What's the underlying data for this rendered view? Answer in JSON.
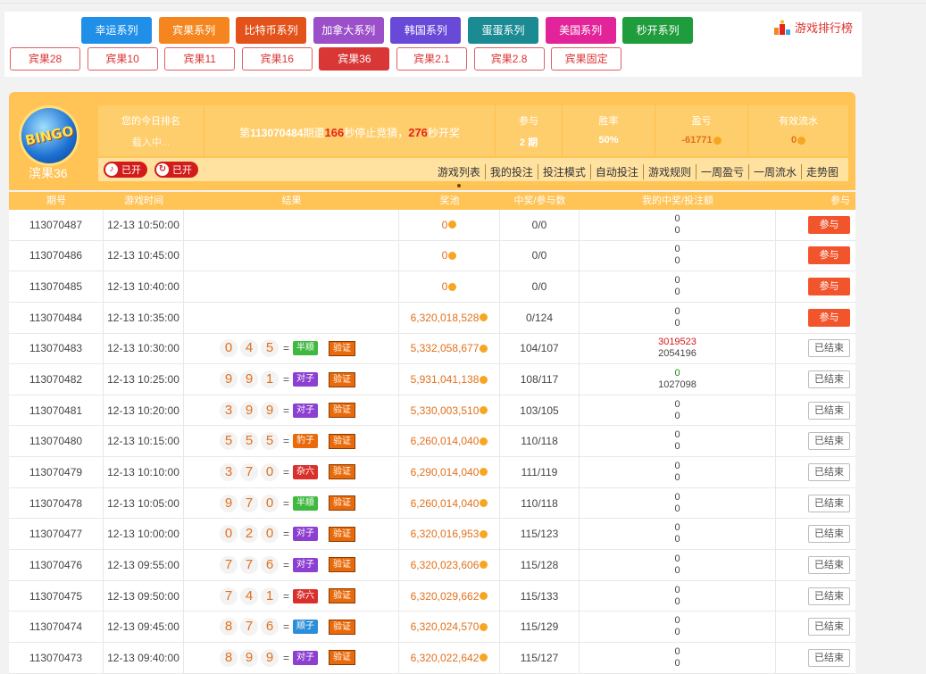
{
  "colors": {
    "accent": "#ffc356",
    "join": "#f2542c",
    "series": [
      "#1f8fe8",
      "#f5861f",
      "#e4521b",
      "#9b4fc9",
      "#6849d8",
      "#1a8a93",
      "#e2239a",
      "#1f9c3c"
    ]
  },
  "series": [
    "幸运系列",
    "宾果系列",
    "比特币系列",
    "加拿大系列",
    "韩国系列",
    "蛋蛋系列",
    "美国系列",
    "秒开系列"
  ],
  "rank_link": "游戏排行榜",
  "games": [
    "宾果28",
    "宾果10",
    "宾果11",
    "宾果16",
    "宾果36",
    "宾果2.1",
    "宾果2.8",
    "宾果固定"
  ],
  "header": {
    "game_name": "滨果36",
    "rank_label": "您的今日排名",
    "rank_value": "载入中...",
    "period_prefix": "第",
    "period_no": "113070484",
    "period_mid": "期還",
    "stop_secs": "166",
    "stop_text": "秒停止竞猜，",
    "open_secs": "276",
    "open_text": "秒开奖",
    "join_label": "参与",
    "join_value": "2 期",
    "winrate_label": "胜率",
    "winrate_value": "50%",
    "profit_label": "盈亏",
    "profit_value": "-61771",
    "flow_label": "有效流水",
    "flow_value": "0",
    "toggle1": "已开",
    "toggle2": "已开",
    "tabs": [
      "游戏列表",
      "我的投注",
      "投注模式",
      "自动投注",
      "游戏规则",
      "一周盈亏",
      "一周流水",
      "走势图"
    ]
  },
  "table": {
    "headers": [
      "期号",
      "游戏时间",
      "结果",
      "奖池",
      "中奖/参与数",
      "我的中奖/投注额",
      "参与"
    ],
    "join_btn": "参与",
    "done_btn": "已结束",
    "verify_btn": "验证",
    "rows": [
      {
        "issue": "113070487",
        "time": "12-13 10:50:00",
        "digits": [],
        "tag": "",
        "tag_color": "",
        "pool": "0",
        "wins": "0/0",
        "win": "0",
        "bet": "0",
        "status": "join"
      },
      {
        "issue": "113070486",
        "time": "12-13 10:45:00",
        "digits": [],
        "tag": "",
        "tag_color": "",
        "pool": "0",
        "wins": "0/0",
        "win": "0",
        "bet": "0",
        "status": "join"
      },
      {
        "issue": "113070485",
        "time": "12-13 10:40:00",
        "digits": [],
        "tag": "",
        "tag_color": "",
        "pool": "0",
        "wins": "0/0",
        "win": "0",
        "bet": "0",
        "status": "join"
      },
      {
        "issue": "113070484",
        "time": "12-13 10:35:00",
        "digits": [],
        "tag": "",
        "tag_color": "",
        "pool": "6,320,018,528",
        "wins": "0/124",
        "win": "0",
        "bet": "0",
        "status": "join"
      },
      {
        "issue": "113070483",
        "time": "12-13 10:30:00",
        "digits": [
          "0",
          "4",
          "5"
        ],
        "tag": "半顺",
        "tag_color": "#3fb83f",
        "pool": "5,332,058,677",
        "wins": "104/107",
        "win": "3019523",
        "bet": "2054196",
        "status": "done",
        "win_color": "red"
      },
      {
        "issue": "113070482",
        "time": "12-13 10:25:00",
        "digits": [
          "9",
          "9",
          "1"
        ],
        "tag": "对子",
        "tag_color": "#8c3fd0",
        "pool": "5,931,041,138",
        "wins": "108/117",
        "win": "0",
        "bet": "1027098",
        "status": "done",
        "win_color": "green"
      },
      {
        "issue": "113070481",
        "time": "12-13 10:20:00",
        "digits": [
          "3",
          "9",
          "9"
        ],
        "tag": "对子",
        "tag_color": "#8c3fd0",
        "pool": "5,330,003,510",
        "wins": "103/105",
        "win": "0",
        "bet": "0",
        "status": "done"
      },
      {
        "issue": "113070480",
        "time": "12-13 10:15:00",
        "digits": [
          "5",
          "5",
          "5"
        ],
        "tag": "豹子",
        "tag_color": "#e86a0a",
        "pool": "6,260,014,040",
        "wins": "110/118",
        "win": "0",
        "bet": "0",
        "status": "done"
      },
      {
        "issue": "113070479",
        "time": "12-13 10:10:00",
        "digits": [
          "3",
          "7",
          "0"
        ],
        "tag": "杂六",
        "tag_color": "#d9302c",
        "pool": "6,290,014,040",
        "wins": "111/119",
        "win": "0",
        "bet": "0",
        "status": "done"
      },
      {
        "issue": "113070478",
        "time": "12-13 10:05:00",
        "digits": [
          "9",
          "7",
          "0"
        ],
        "tag": "半顺",
        "tag_color": "#3fb83f",
        "pool": "6,260,014,040",
        "wins": "110/118",
        "win": "0",
        "bet": "0",
        "status": "done"
      },
      {
        "issue": "113070477",
        "time": "12-13 10:00:00",
        "digits": [
          "0",
          "2",
          "0"
        ],
        "tag": "对子",
        "tag_color": "#8c3fd0",
        "pool": "6,320,016,953",
        "wins": "115/123",
        "win": "0",
        "bet": "0",
        "status": "done"
      },
      {
        "issue": "113070476",
        "time": "12-13 09:55:00",
        "digits": [
          "7",
          "7",
          "6"
        ],
        "tag": "对子",
        "tag_color": "#8c3fd0",
        "pool": "6,320,023,606",
        "wins": "115/128",
        "win": "0",
        "bet": "0",
        "status": "done"
      },
      {
        "issue": "113070475",
        "time": "12-13 09:50:00",
        "digits": [
          "7",
          "4",
          "1"
        ],
        "tag": "杂六",
        "tag_color": "#d9302c",
        "pool": "6,320,029,662",
        "wins": "115/133",
        "win": "0",
        "bet": "0",
        "status": "done"
      },
      {
        "issue": "113070474",
        "time": "12-13 09:45:00",
        "digits": [
          "8",
          "7",
          "6"
        ],
        "tag": "顺子",
        "tag_color": "#2a8fd8",
        "pool": "6,320,024,570",
        "wins": "115/129",
        "win": "0",
        "bet": "0",
        "status": "done"
      },
      {
        "issue": "113070473",
        "time": "12-13 09:40:00",
        "digits": [
          "8",
          "9",
          "9"
        ],
        "tag": "对子",
        "tag_color": "#8c3fd0",
        "pool": "6,320,022,642",
        "wins": "115/127",
        "win": "0",
        "bet": "0",
        "status": "done"
      }
    ]
  }
}
